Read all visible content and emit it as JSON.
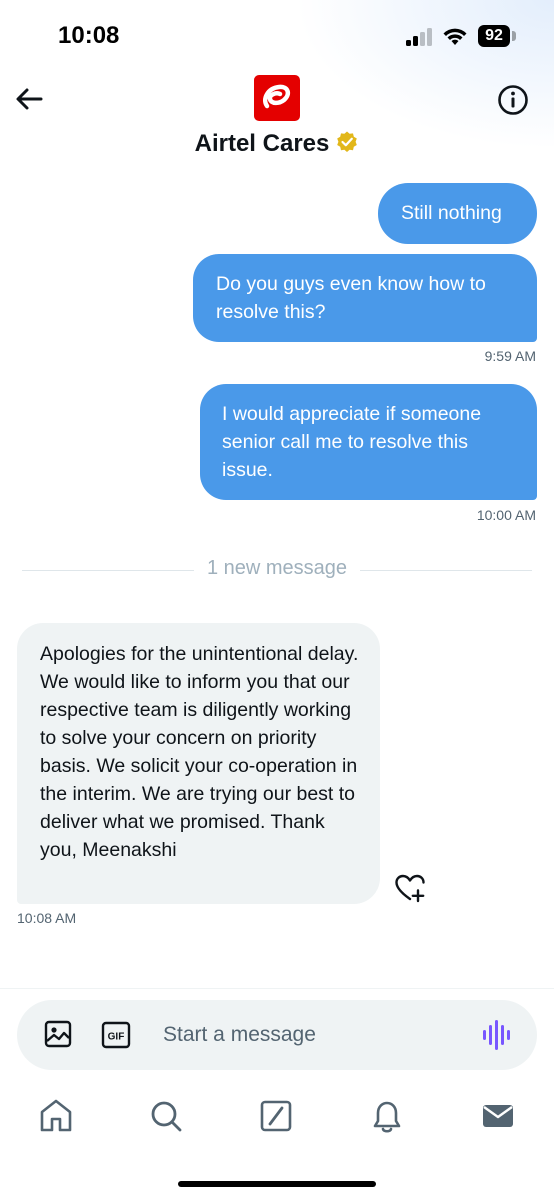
{
  "status_bar": {
    "time": "10:08",
    "battery": "92"
  },
  "header": {
    "name": "Airtel Cares",
    "verified": true,
    "brand_color": "#e40000",
    "back_icon": "arrow-left-icon",
    "info_icon": "info-icon"
  },
  "messages": [
    {
      "direction": "outgoing",
      "text": "Still nothing"
    },
    {
      "direction": "outgoing",
      "text": "Do you guys even know how to resolve this?",
      "time": "9:59 AM"
    },
    {
      "direction": "outgoing",
      "text": "I would appreciate if someone senior call me to resolve this issue.",
      "time": "10:00 AM"
    },
    {
      "direction": "incoming",
      "text": "Apologies for the unintentional delay. We would like to inform you that our respective team is diligently working to solve your concern on priority basis. We solicit your co-operation in the interim. We are trying our best to deliver what we promised. Thank you, Meenakshi",
      "time": "10:08 AM"
    }
  ],
  "divider": {
    "new_message_label": "1 new message"
  },
  "composer": {
    "placeholder": "Start a message",
    "gif_label": "GIF"
  },
  "colors": {
    "outgoing_bubble": "#4a99e9",
    "incoming_bubble": "#eff3f4",
    "voice_accent": "#7856ff"
  },
  "bottom_nav": {
    "items": [
      "home-icon",
      "search-icon",
      "grok-icon",
      "notifications-icon",
      "messages-icon"
    ]
  }
}
